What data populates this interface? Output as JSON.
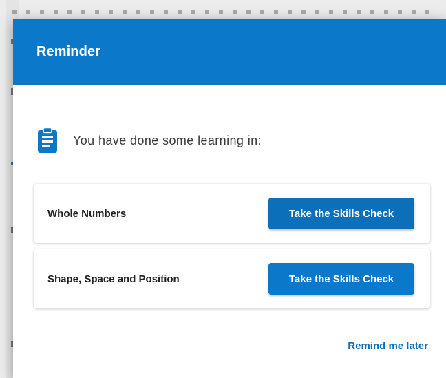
{
  "dialog": {
    "title": "Reminder",
    "intro_text": "You have done some learning in:",
    "topics": [
      {
        "name": "Whole Numbers",
        "action_label": "Take the Skills Check"
      },
      {
        "name": "Shape, Space and Position",
        "action_label": "Take the Skills Check"
      }
    ],
    "remind_later_label": "Remind me later"
  },
  "colors": {
    "header_bg": "#0b78c9",
    "button_bg": "#0b6fba",
    "link_color": "#0b6fba"
  },
  "icons": {
    "intro_icon": "clipboard-text-icon"
  }
}
